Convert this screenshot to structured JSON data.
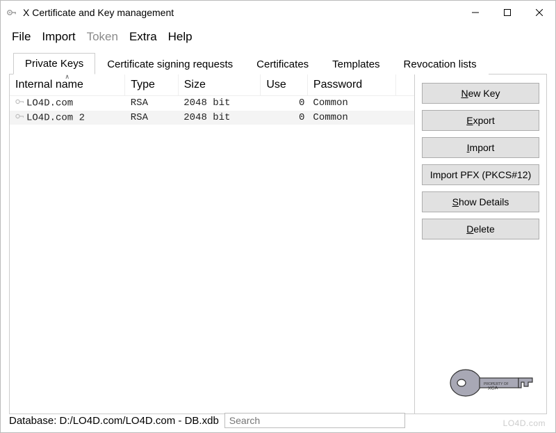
{
  "window": {
    "title": "X Certificate and Key management",
    "minimize_icon": "minimize",
    "maximize_icon": "maximize",
    "close_icon": "close"
  },
  "menu": {
    "items": [
      {
        "label": "File",
        "enabled": true
      },
      {
        "label": "Import",
        "enabled": true
      },
      {
        "label": "Token",
        "enabled": false
      },
      {
        "label": "Extra",
        "enabled": true
      },
      {
        "label": "Help",
        "enabled": true
      }
    ]
  },
  "tabs": {
    "items": [
      {
        "label": "Private Keys",
        "active": true
      },
      {
        "label": "Certificate signing requests",
        "active": false
      },
      {
        "label": "Certificates",
        "active": false
      },
      {
        "label": "Templates",
        "active": false
      },
      {
        "label": "Revocation lists",
        "active": false
      }
    ]
  },
  "table": {
    "columns": {
      "internal_name": "Internal name",
      "type": "Type",
      "size": "Size",
      "use": "Use",
      "password": "Password"
    },
    "rows": [
      {
        "name": "LO4D.com",
        "type": "RSA",
        "size": "2048 bit",
        "use": "0",
        "password": "Common"
      },
      {
        "name": "LO4D.com 2",
        "type": "RSA",
        "size": "2048 bit",
        "use": "0",
        "password": "Common"
      }
    ]
  },
  "sidebar": {
    "new_key": {
      "pre": "",
      "ul": "N",
      "post": "ew Key"
    },
    "export": {
      "pre": "",
      "ul": "E",
      "post": "xport"
    },
    "import": {
      "pre": "",
      "ul": "I",
      "post": "mport"
    },
    "import_pfx": {
      "pre": "Import PFX (PKCS#12)",
      "ul": "",
      "post": ""
    },
    "show_details": {
      "pre": "",
      "ul": "S",
      "post": "how Details"
    },
    "delete": {
      "pre": "",
      "ul": "D",
      "post": "elete"
    }
  },
  "status": {
    "database_label": "Database: D:/LO4D.com/LO4D.com - DB.xdb",
    "search_placeholder": "Search"
  },
  "watermark": "LO4D.com"
}
